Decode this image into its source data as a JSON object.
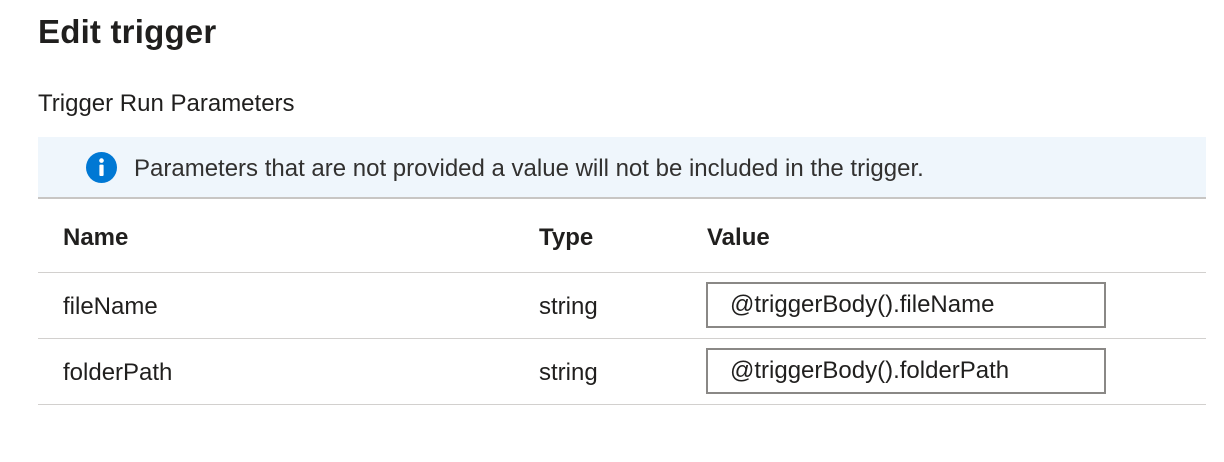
{
  "panel": {
    "title": "Edit trigger",
    "section_title": "Trigger Run Parameters"
  },
  "info": {
    "icon": "info-icon",
    "message": "Parameters that are not provided a value will not be included in the trigger.",
    "accent_color": "#0078d4"
  },
  "table": {
    "headers": {
      "name": "Name",
      "type": "Type",
      "value": "Value"
    },
    "rows": [
      {
        "name": "fileName",
        "type": "string",
        "value": "@triggerBody().fileName"
      },
      {
        "name": "folderPath",
        "type": "string",
        "value": "@triggerBody().folderPath"
      }
    ]
  }
}
